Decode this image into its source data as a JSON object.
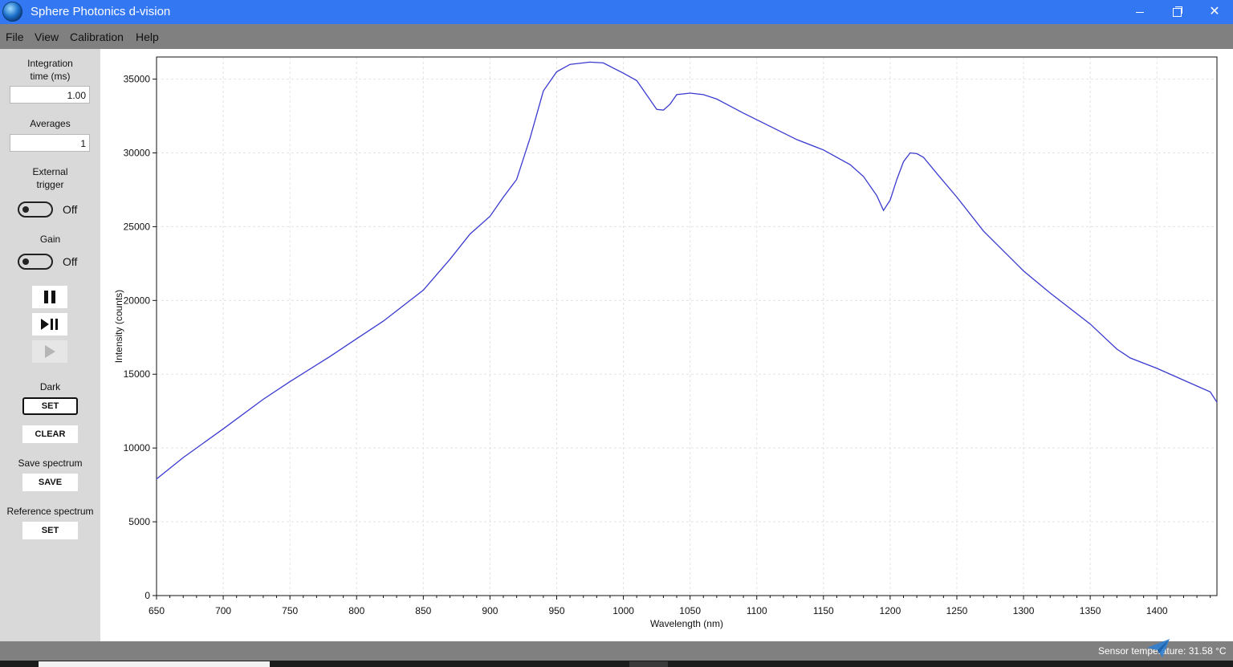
{
  "window": {
    "title": "Sphere Photonics d-vision"
  },
  "menu": [
    "File",
    "View",
    "Calibration",
    "Help"
  ],
  "panel": {
    "integration_label_line1": "Integration",
    "integration_label_line2": "time (ms)",
    "integration_value": "1.00",
    "averages_label": "Averages",
    "averages_value": "1",
    "external_trigger_line1": "External",
    "external_trigger_line2": "trigger",
    "external_trigger_state": "Off",
    "gain_label": "Gain",
    "gain_state": "Off",
    "dark_label": "Dark",
    "dark_set": "SET",
    "dark_clear": "CLEAR",
    "save_label": "Save spectrum",
    "save_button": "SAVE",
    "reference_label": "Reference spectrum",
    "reference_set": "SET"
  },
  "status": {
    "text": "Sensor temperature: 31.58 °C"
  },
  "colors": {
    "series": "#3a3ad0",
    "titlebar": "#3477f2",
    "menubar": "#808080",
    "panel": "#d9d9d9"
  },
  "chart_data": {
    "type": "line",
    "title": "",
    "xlabel": "Wavelength (nm)",
    "ylabel": "Intensity (counts)",
    "xlim": [
      650,
      1445
    ],
    "ylim": [
      0,
      36500
    ],
    "xticks": [
      650,
      700,
      750,
      800,
      850,
      900,
      950,
      1000,
      1050,
      1100,
      1150,
      1200,
      1250,
      1300,
      1350,
      1400
    ],
    "yticks": [
      0,
      5000,
      10000,
      15000,
      20000,
      25000,
      30000,
      35000
    ],
    "grid": true,
    "series": [
      {
        "x": [
          650,
          670,
          700,
          730,
          750,
          780,
          800,
          820,
          850,
          870,
          885,
          900,
          910,
          920,
          930,
          940,
          950,
          960,
          975,
          985,
          1000,
          1010,
          1020,
          1025,
          1030,
          1035,
          1040,
          1050,
          1060,
          1070,
          1090,
          1110,
          1130,
          1150,
          1170,
          1180,
          1190,
          1195,
          1200,
          1205,
          1210,
          1215,
          1220,
          1225,
          1235,
          1250,
          1270,
          1300,
          1320,
          1350,
          1370,
          1380,
          1400,
          1420,
          1440,
          1445
        ],
        "y": [
          7900,
          9350,
          11300,
          13300,
          14500,
          16200,
          17400,
          18600,
          20700,
          22800,
          24500,
          25700,
          27000,
          28200,
          31000,
          34200,
          35500,
          36000,
          36150,
          36100,
          35400,
          34900,
          33600,
          32950,
          32900,
          33300,
          33950,
          34050,
          33950,
          33650,
          32700,
          31800,
          30900,
          30200,
          29200,
          28400,
          27100,
          26100,
          26800,
          28200,
          29400,
          30000,
          29950,
          29700,
          28600,
          27000,
          24700,
          22000,
          20500,
          18400,
          16700,
          16100,
          15400,
          14600,
          13800,
          13100
        ]
      }
    ]
  }
}
